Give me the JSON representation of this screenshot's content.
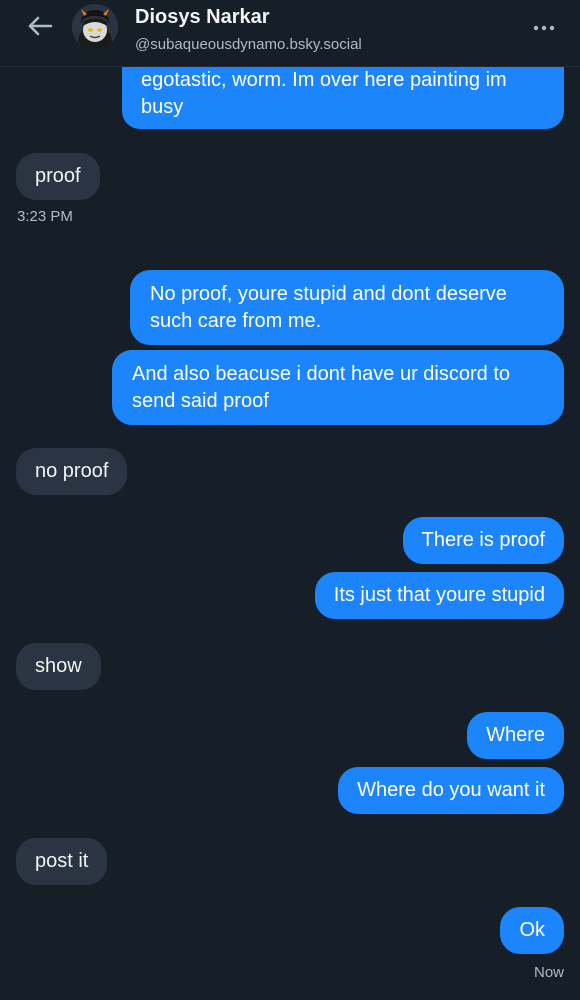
{
  "header": {
    "back_icon": "arrow-left-icon",
    "contact_name": "Diosys Narkar",
    "contact_handle": "@subaqueousdynamo.bsky.social",
    "more_icon": "ellipsis-icon"
  },
  "messages": [
    {
      "direction": "out",
      "lines": [
        "egotastic, worm. Im over here painting im",
        "busy"
      ]
    },
    {
      "direction": "in",
      "text": "proof"
    },
    {
      "timestamp": "3:23 PM"
    },
    {
      "direction": "out",
      "lines": [
        "No proof, youre stupid and dont deserve",
        "such care from me."
      ]
    },
    {
      "direction": "out",
      "lines": [
        "And also beacuse i dont have ur discord to",
        "send said proof"
      ]
    },
    {
      "direction": "in",
      "text": "no proof"
    },
    {
      "direction": "out",
      "text": "There is proof"
    },
    {
      "direction": "out",
      "text": "Its just that youre stupid"
    },
    {
      "direction": "in",
      "text": "show"
    },
    {
      "direction": "out",
      "text": "Where"
    },
    {
      "direction": "out",
      "text": "Where do you want it"
    },
    {
      "direction": "in",
      "text": "post it"
    },
    {
      "direction": "out",
      "text": "Ok"
    },
    {
      "timestamp": "Now"
    }
  ],
  "colors": {
    "background": "#161e27",
    "outgoing_bubble": "#1d85fc",
    "incoming_bubble": "#2a3442",
    "muted_text": "#aebbc9"
  }
}
